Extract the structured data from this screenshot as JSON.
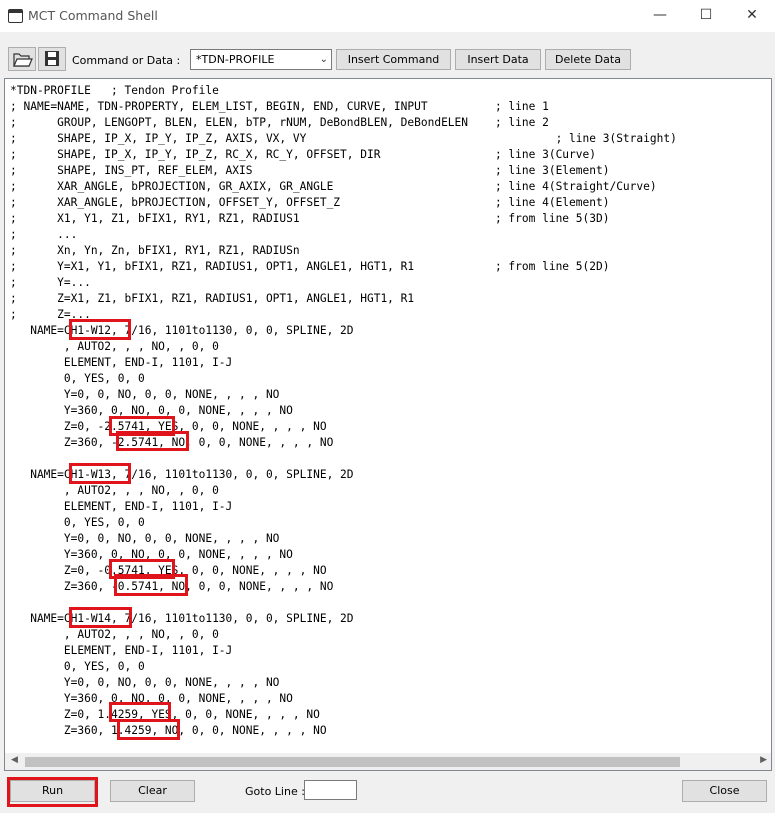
{
  "window": {
    "title": "MCT Command Shell",
    "minimize_glyph": "—",
    "maximize_glyph": "☐",
    "close_glyph": "✕"
  },
  "toolbar": {
    "open_icon": "folder-open-icon",
    "save_icon": "save-icon",
    "label": "Command or Data :",
    "select_value": "*TDN-PROFILE",
    "insert_command": "Insert Command",
    "insert_data": "Insert Data",
    "delete_data": "Delete Data"
  },
  "editor": {
    "lines": [
      "*TDN-PROFILE   ; Tendon Profile",
      "; NAME=NAME, TDN-PROPERTY, ELEM_LIST, BEGIN, END, CURVE, INPUT          ; line 1",
      ";      GROUP, LENGOPT, BLEN, ELEN, bTP, rNUM, DeBondBLEN, DeBondELEN    ; line 2",
      ";      SHAPE, IP_X, IP_Y, IP_Z, AXIS, VX, VY                                     ; line 3(Straight)",
      ";      SHAPE, IP_X, IP_Y, IP_Z, RC_X, RC_Y, OFFSET, DIR                 ; line 3(Curve)",
      ";      SHAPE, INS_PT, REF_ELEM, AXIS                                    ; line 3(Element)",
      ";      XAR_ANGLE, bPROJECTION, GR_AXIX, GR_ANGLE                        ; line 4(Straight/Curve)",
      ";      XAR_ANGLE, bPROJECTION, OFFSET_Y, OFFSET_Z                       ; line 4(Element)",
      ";      X1, Y1, Z1, bFIX1, RY1, RZ1, RADIUS1                             ; from line 5(3D)",
      ";      ...",
      ";      Xn, Yn, Zn, bFIX1, RY1, RZ1, RADIUSn",
      ";      Y=X1, Y1, bFIX1, RZ1, RADIUS1, OPT1, ANGLE1, HGT1, R1            ; from line 5(2D)",
      ";      Y=...",
      ";      Z=X1, Z1, bFIX1, RZ1, RADIUS1, OPT1, ANGLE1, HGT1, R1",
      ";      Z=...",
      "   NAME=CH1-W12, 7/16, 1101to1130, 0, 0, SPLINE, 2D",
      "        , AUTO2, , , NO, , 0, 0",
      "        ELEMENT, END-I, 1101, I-J",
      "        0, YES, 0, 0",
      "        Y=0, 0, NO, 0, 0, NONE, , , , NO",
      "        Y=360, 0, NO, 0, 0, NONE, , , , NO",
      "        Z=0, -2.5741, YES, 0, 0, NONE, , , , NO",
      "        Z=360, -2.5741, NO, 0, 0, NONE, , , , NO",
      "",
      "   NAME=CH1-W13, 7/16, 1101to1130, 0, 0, SPLINE, 2D",
      "        , AUTO2, , , NO, , 0, 0",
      "        ELEMENT, END-I, 1101, I-J",
      "        0, YES, 0, 0",
      "        Y=0, 0, NO, 0, 0, NONE, , , , NO",
      "        Y=360, 0, NO, 0, 0, NONE, , , , NO",
      "        Z=0, -0.5741, YES, 0, 0, NONE, , , , NO",
      "        Z=360, -0.5741, NO, 0, 0, NONE, , , , NO",
      "",
      "   NAME=CH1-W14, 7/16, 1101to1130, 0, 0, SPLINE, 2D",
      "        , AUTO2, , , NO, , 0, 0",
      "        ELEMENT, END-I, 1101, I-J",
      "        0, YES, 0, 0",
      "        Y=0, 0, NO, 0, 0, NONE, , , , NO",
      "        Y=360, 0, NO, 0, 0, NONE, , , , NO",
      "        Z=0, 1.4259, YES, 0, 0, NONE, , , , NO",
      "        Z=360, 1.4259, NO, 0, 0, NONE, , , , NO"
    ],
    "highlight_color": "#e0151b"
  },
  "bottom": {
    "run": "Run",
    "clear": "Clear",
    "goto_label": "Goto Line :",
    "goto_value": "",
    "close": "Close"
  }
}
